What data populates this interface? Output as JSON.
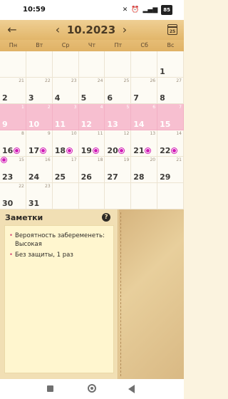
{
  "status_bar": {
    "time": "10:59",
    "battery": "85"
  },
  "header": {
    "month": "10.2023",
    "calendar_icon_day": "25"
  },
  "weekdays": [
    "Пн",
    "Вт",
    "Ср",
    "Чт",
    "Пт",
    "Сб",
    "Вс"
  ],
  "calendar": {
    "rows": [
      {
        "pink": false,
        "cells": [
          {
            "big": "",
            "small": ""
          },
          {
            "big": "",
            "small": ""
          },
          {
            "big": "",
            "small": ""
          },
          {
            "big": "",
            "small": ""
          },
          {
            "big": "",
            "small": ""
          },
          {
            "big": "",
            "small": ""
          },
          {
            "big": "1",
            "small": ""
          }
        ]
      },
      {
        "pink": false,
        "cells": [
          {
            "big": "2",
            "small": "21"
          },
          {
            "big": "3",
            "small": "22"
          },
          {
            "big": "4",
            "small": "23"
          },
          {
            "big": "5",
            "small": "24"
          },
          {
            "big": "6",
            "small": "25"
          },
          {
            "big": "7",
            "small": "26"
          },
          {
            "big": "8",
            "small": "27"
          }
        ]
      },
      {
        "pink": true,
        "cells": [
          {
            "big": "9",
            "small": "1"
          },
          {
            "big": "10",
            "small": "2"
          },
          {
            "big": "11",
            "small": "3"
          },
          {
            "big": "12",
            "small": "4"
          },
          {
            "big": "13",
            "small": "5"
          },
          {
            "big": "14",
            "small": "6"
          },
          {
            "big": "15",
            "small": "7"
          }
        ]
      },
      {
        "pink": false,
        "cells": [
          {
            "big": "16",
            "small": "8",
            "dot": true
          },
          {
            "big": "17",
            "small": "9",
            "dot": true
          },
          {
            "big": "18",
            "small": "10",
            "dot": true
          },
          {
            "big": "19",
            "small": "11",
            "dot": true
          },
          {
            "big": "20",
            "small": "12",
            "dot": true
          },
          {
            "big": "21",
            "small": "13",
            "dot": true
          },
          {
            "big": "22",
            "small": "14",
            "dot": true
          }
        ]
      },
      {
        "pink": false,
        "cells": [
          {
            "big": "23",
            "small": "15",
            "dot": true
          },
          {
            "big": "24",
            "small": "16"
          },
          {
            "big": "25",
            "small": "17"
          },
          {
            "big": "26",
            "small": "18"
          },
          {
            "big": "27",
            "small": "19"
          },
          {
            "big": "28",
            "small": "20"
          },
          {
            "big": "29",
            "small": "21"
          }
        ]
      },
      {
        "pink": false,
        "cells": [
          {
            "big": "30",
            "small": "22"
          },
          {
            "big": "31",
            "small": "23"
          },
          {
            "big": "",
            "small": ""
          },
          {
            "big": "",
            "small": ""
          },
          {
            "big": "",
            "small": ""
          },
          {
            "big": "",
            "small": ""
          },
          {
            "big": "",
            "small": ""
          }
        ]
      }
    ]
  },
  "notes": {
    "title": "Заметки",
    "items": [
      "Вероятность забеременеть: Высокая",
      "Без защиты, 1 раз"
    ]
  },
  "colors": {
    "accent": "#e2b66a",
    "pink_row": "#f7bfd0",
    "dot": "#d11bb6"
  }
}
